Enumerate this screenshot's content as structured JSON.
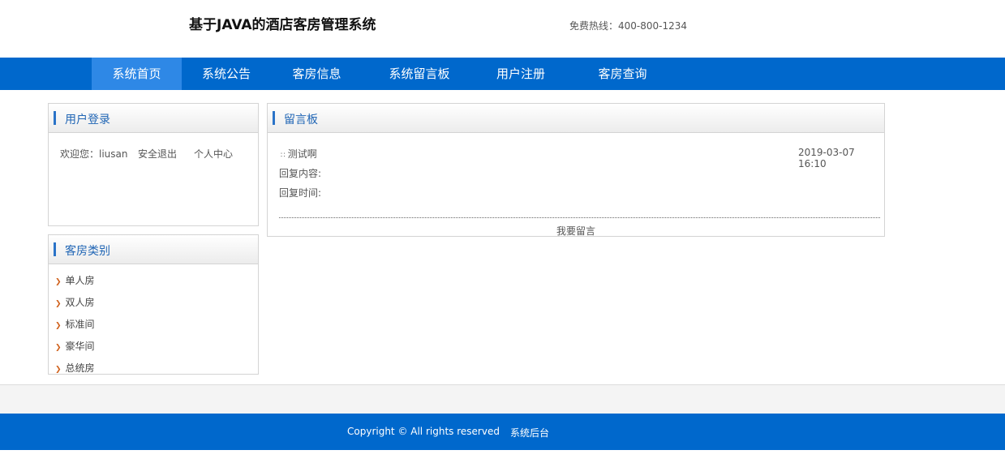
{
  "header": {
    "title": "基于JAVA的酒店客房管理系统",
    "hotline_label": "免费热线：",
    "hotline_number": "400-800-1234"
  },
  "nav": {
    "items": [
      {
        "label": "系统首页",
        "active": true
      },
      {
        "label": "系统公告",
        "active": false
      },
      {
        "label": "客房信息",
        "active": false
      },
      {
        "label": "系统留言板",
        "active": false
      },
      {
        "label": "用户注册",
        "active": false
      },
      {
        "label": "客房查询",
        "active": false
      }
    ]
  },
  "login_panel": {
    "title": "用户登录",
    "welcome_label": "欢迎您：",
    "username": "liusan",
    "logout": "安全退出",
    "personal_center": "个人中心"
  },
  "category_panel": {
    "title": "客房类别",
    "items": [
      "单人房",
      "双人房",
      "标准间",
      "豪华间",
      "总统房"
    ]
  },
  "message_board": {
    "title": "留言板",
    "message": {
      "title": "测试啊",
      "time": "2019-03-07 16:10",
      "reply_content_label": "回复内容:",
      "reply_time_label": "回复时间:"
    },
    "leave_message": "我要留言"
  },
  "footer": {
    "copyright": "Copyright © All rights reserved",
    "admin_link": "系统后台"
  },
  "colors": {
    "nav_background": "#0068cc",
    "nav_active": "#2e88e6",
    "panel_title": "#2166b5",
    "panel_accent_bar": "#2a73c8",
    "category_arrow": "#d0611c"
  }
}
